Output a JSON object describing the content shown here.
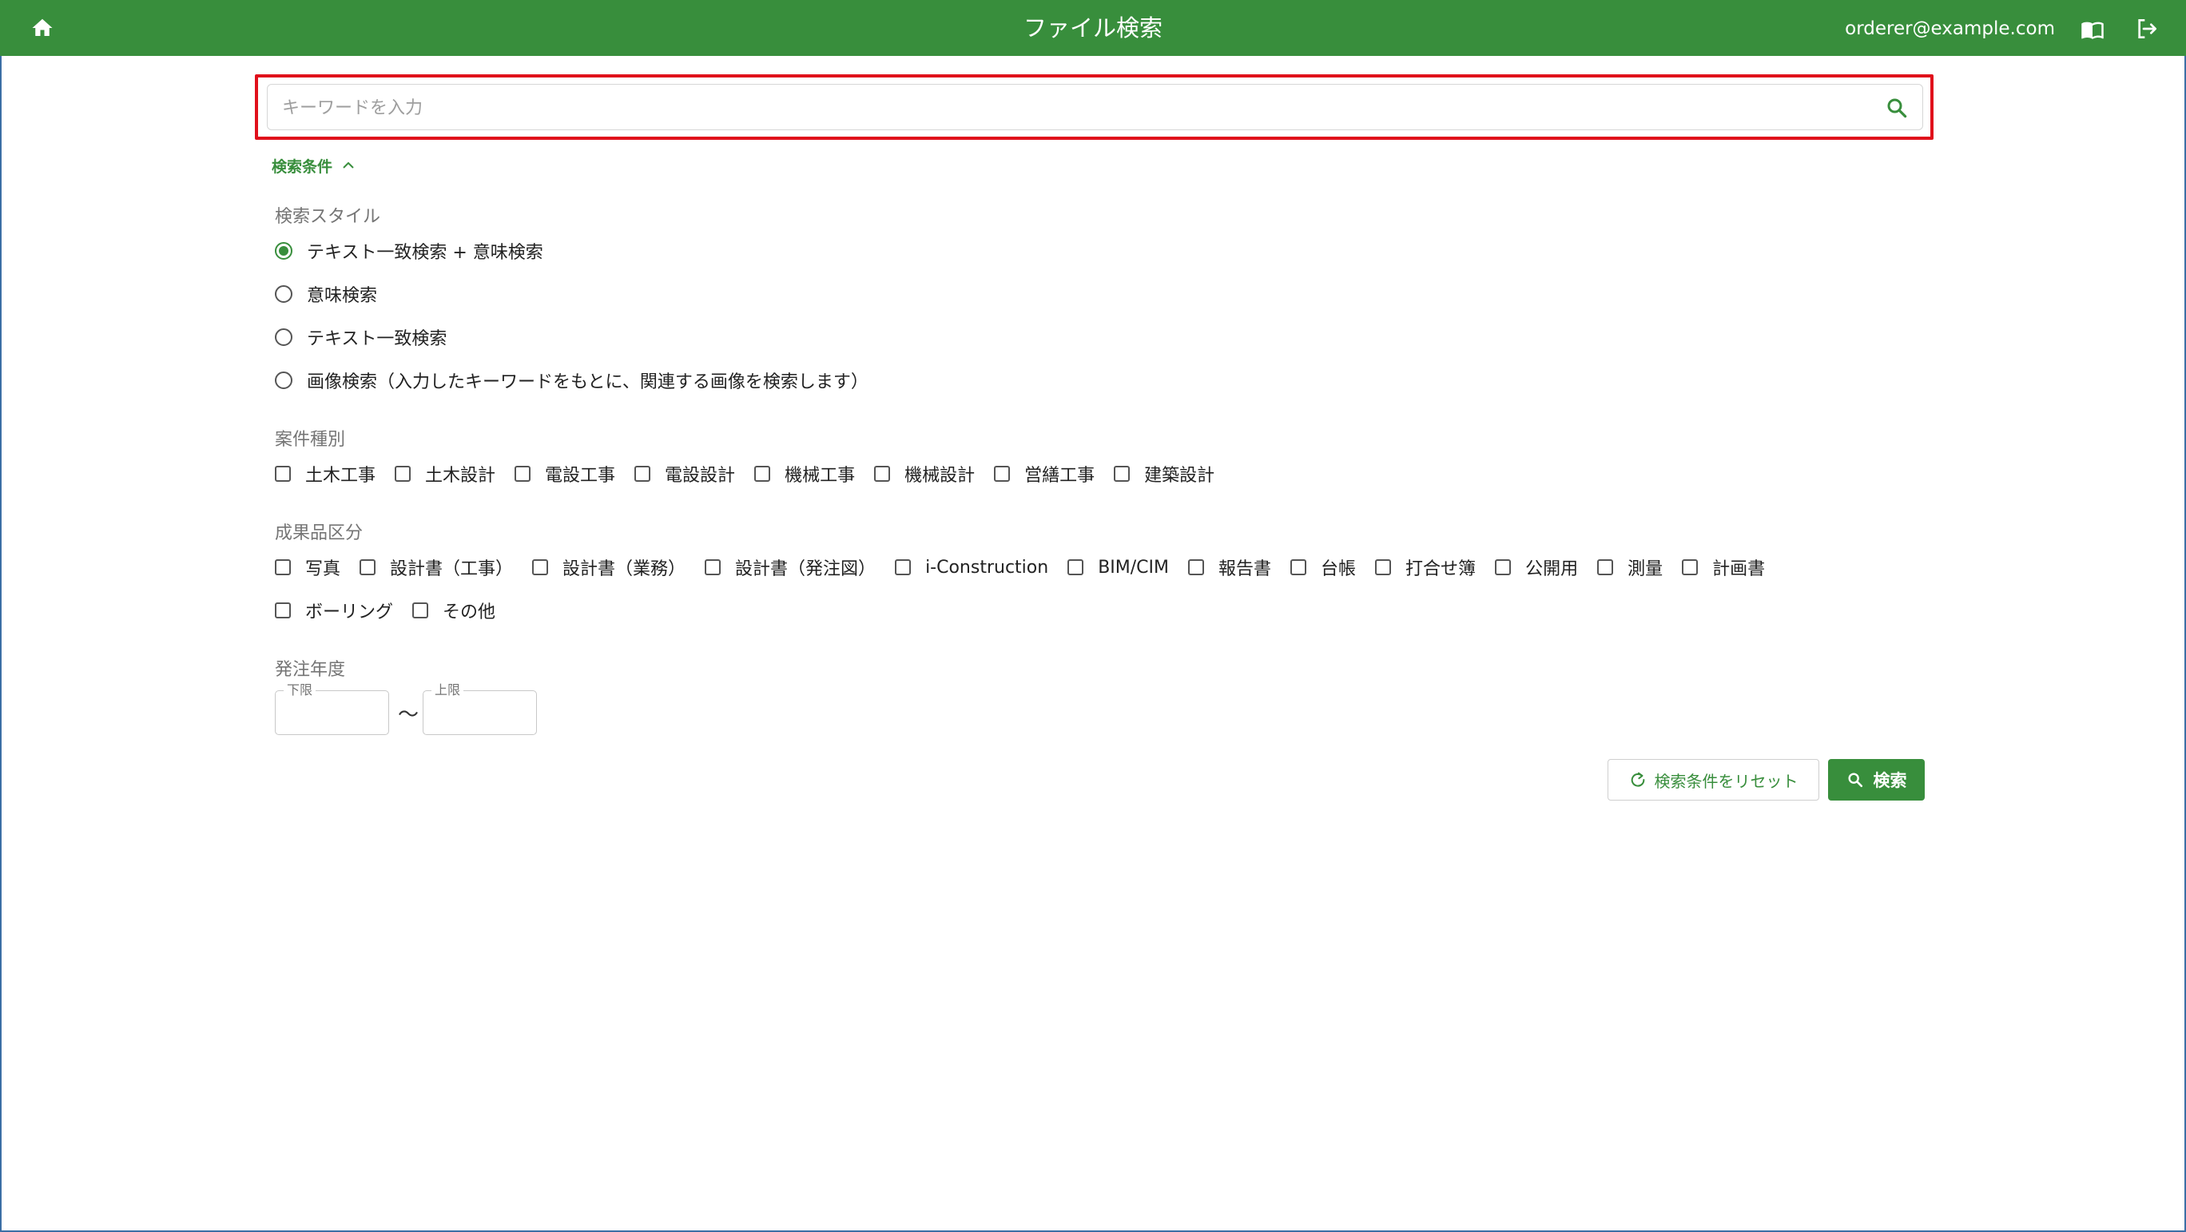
{
  "header": {
    "title": "ファイル検索",
    "user_email": "orderer@example.com",
    "home_icon": "home-icon",
    "manual_icon": "book-open-icon",
    "logout_icon": "logout-icon",
    "bg_color": "#388e3c"
  },
  "search": {
    "placeholder": "キーワードを入力",
    "value": "",
    "icon": "search-icon",
    "highlight_color": "#e0101b"
  },
  "conditions": {
    "toggle_label": "検索条件",
    "toggle_icon": "chevron-up-icon",
    "search_style": {
      "label": "検索スタイル",
      "options": [
        {
          "label": "テキスト一致検索 + 意味検索",
          "selected": true
        },
        {
          "label": "意味検索",
          "selected": false
        },
        {
          "label": "テキスト一致検索",
          "selected": false
        },
        {
          "label": "画像検索（入力したキーワードをもとに、関連する画像を検索します）",
          "selected": false
        }
      ]
    },
    "project_type": {
      "label": "案件種別",
      "options": [
        "土木工事",
        "土木設計",
        "電設工事",
        "電設設計",
        "機械工事",
        "機械設計",
        "営繕工事",
        "建築設計"
      ]
    },
    "deliverable_type": {
      "label": "成果品区分",
      "options_row1": [
        "写真",
        "設計書（工事）",
        "設計書（業務）",
        "設計書（発注図）",
        "i-Construction",
        "BIM/CIM",
        "報告書",
        "台帳",
        "打合せ簿",
        "公開用",
        "測量",
        "計画書"
      ],
      "options_row2": [
        "ボーリング",
        "その他"
      ]
    },
    "order_year": {
      "label": "発注年度",
      "lower_label": "下限",
      "upper_label": "上限",
      "lower_value": "",
      "upper_value": "",
      "separator": "〜"
    }
  },
  "actions": {
    "reset_label": "検索条件をリセット",
    "reset_icon": "refresh-icon",
    "search_label": "検索",
    "search_icon": "search-icon"
  }
}
